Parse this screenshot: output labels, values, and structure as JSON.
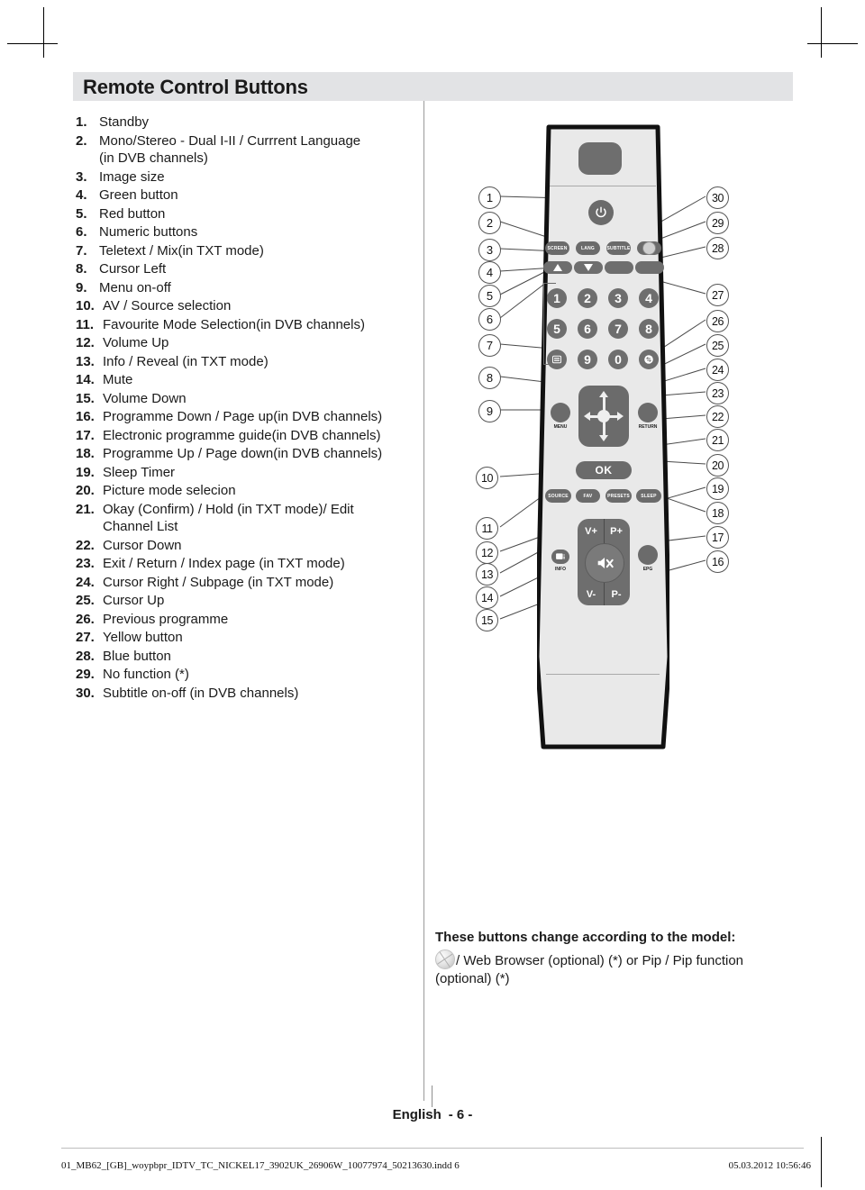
{
  "page": {
    "title": "Remote Control Buttons",
    "language_label": "English",
    "page_number": "- 6 -"
  },
  "button_list": [
    {
      "num": "1.",
      "text": "Standby"
    },
    {
      "num": "2.",
      "text": "Mono/Stereo - Dual I-II / Currrent  Language",
      "cont": "(in DVB channels)"
    },
    {
      "num": "3.",
      "text": "Image size"
    },
    {
      "num": "4.",
      "text": "Green button"
    },
    {
      "num": "5.",
      "text": "Red button"
    },
    {
      "num": "6.",
      "text": "Numeric buttons"
    },
    {
      "num": "7.",
      "text": "Teletext  / Mix(in TXT mode)"
    },
    {
      "num": "8.",
      "text": "Cursor Left"
    },
    {
      "num": "9.",
      "text": "Menu on-off"
    },
    {
      "num": "10.",
      "text": "AV / Source selection"
    },
    {
      "num": "11.",
      "text": "Favourite Mode Selection(in DVB channels)"
    },
    {
      "num": "12.",
      "text": "Volume Up"
    },
    {
      "num": "13.",
      "text": "Info / Reveal (in TXT mode)"
    },
    {
      "num": "14.",
      "text": "Mute"
    },
    {
      "num": "15.",
      "text": "Volume Down"
    },
    {
      "num": "16.",
      "text": "Programme Down / Page up(in DVB channels)"
    },
    {
      "num": "17.",
      "text": "Electronic programme guide(in DVB channels)"
    },
    {
      "num": "18.",
      "text": "Programme Up / Page down(in DVB channels)"
    },
    {
      "num": "19.",
      "text": "Sleep Timer"
    },
    {
      "num": "20.",
      "text": "Picture mode selecion"
    },
    {
      "num": "21.",
      "text": "Okay (Confirm) / Hold (in TXT mode)/ Edit",
      "cont": "Channel List"
    },
    {
      "num": "22.",
      "text": "Cursor Down"
    },
    {
      "num": "23.",
      "text": "Exit / Return / Index page (in TXT mode)"
    },
    {
      "num": "24.",
      "text": "Cursor Right / Subpage (in TXT mode)"
    },
    {
      "num": "25.",
      "text": "Cursor Up"
    },
    {
      "num": "26.",
      "text": "Previous programme"
    },
    {
      "num": "27.",
      "text": "Yellow button"
    },
    {
      "num": "28.",
      "text": "Blue button"
    },
    {
      "num": "29.",
      "text": "No function (*)"
    },
    {
      "num": "30.",
      "text": "Subtitle on-off (in DVB channels)"
    }
  ],
  "remote": {
    "power_icon": "power-icon",
    "function_keys": [
      {
        "label": "SCREEN"
      },
      {
        "label": "LANG"
      },
      {
        "label": "SUBTITLE"
      },
      {
        "label": "",
        "icon": "web-globe-icon"
      }
    ],
    "colour_keys": [
      {
        "name": "red-key",
        "glyph": "triangle-up"
      },
      {
        "name": "green-key",
        "glyph": "triangle-down"
      },
      {
        "name": "yellow-key",
        "glyph": ""
      },
      {
        "name": "blue-key",
        "glyph": ""
      }
    ],
    "numeric_rows": [
      [
        "1",
        "2",
        "3",
        "4"
      ],
      [
        "5",
        "6",
        "7",
        "8"
      ],
      [
        "teletext-icon",
        "9",
        "0",
        "swap-icon"
      ]
    ],
    "menu_label": "MENU",
    "return_label": "RETURN",
    "ok_label": "OK",
    "mode_keys": [
      {
        "label": "SOURCE"
      },
      {
        "label": "FAV"
      },
      {
        "label": "PRESETS"
      },
      {
        "label": "SLEEP"
      }
    ],
    "pad_labels": {
      "volume_up": "V+",
      "programme_up": "P+",
      "volume_down": "V-",
      "programme_down": "P-"
    },
    "info_label": "INFO",
    "epg_label": "EPG",
    "mute_icon": "mute-icon"
  },
  "callouts": {
    "left": [
      "1",
      "2",
      "3",
      "4",
      "5",
      "6",
      "7",
      "8",
      "9",
      "10",
      "11",
      "12",
      "13",
      "14",
      "15"
    ],
    "right": [
      "30",
      "29",
      "28",
      "27",
      "26",
      "25",
      "24",
      "23",
      "22",
      "21",
      "20",
      "19",
      "18",
      "17",
      "16"
    ]
  },
  "model_note": {
    "title": "These buttons change according to the model:",
    "icon": "web-globe-icon",
    "body": "/ Web Browser (optional) (*) or Pip / Pip function (optional) (*)"
  },
  "print_footer": {
    "file": "01_MB62_[GB]_woypbpr_IDTV_TC_NICKEL17_3902UK_26906W_10077974_50213630.indd   6",
    "stamp": "05.03.2012   10:56:46"
  },
  "colors": {
    "header_band": "#e2e3e5",
    "remote_face": "#e9e9e9",
    "button_grey": "#6e6e6e",
    "outline": "#111111"
  }
}
